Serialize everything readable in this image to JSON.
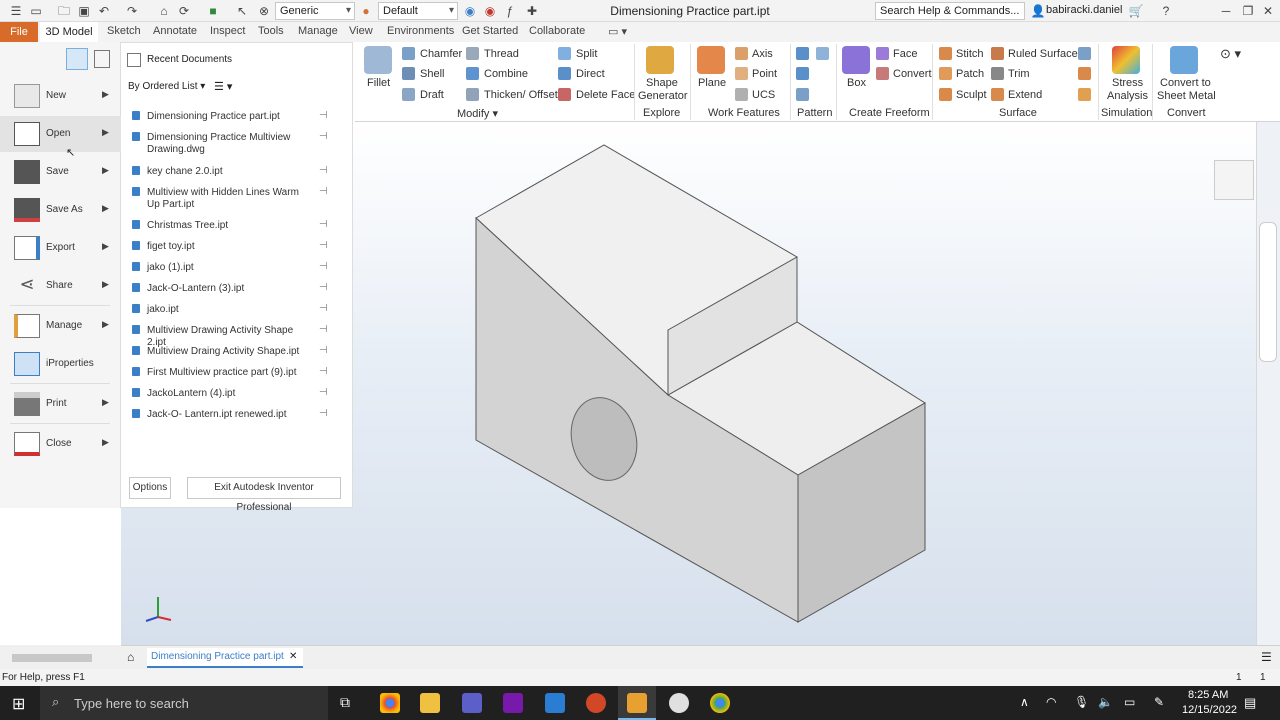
{
  "titlebar": {
    "material": "Generic",
    "appearance": "Default",
    "title": "Dimensioning Practice part.ipt",
    "search_placeholder": "Search Help & Commands...",
    "user": "babiracki.daniel"
  },
  "tabs": {
    "file": "File",
    "model": "3D Model",
    "sketch": "Sketch",
    "annotate": "Annotate",
    "inspect": "Inspect",
    "tools": "Tools",
    "manage": "Manage",
    "view": "View",
    "environments": "Environments",
    "get_started": "Get Started",
    "collaborate": "Collaborate"
  },
  "ribbon": {
    "fillet": "Fillet",
    "chamfer": "Chamfer",
    "shell": "Shell",
    "draft": "Draft",
    "thread": "Thread",
    "combine": "Combine",
    "thicken": "Thicken/ Offset",
    "split": "Split",
    "direct": "Direct",
    "delete_face": "Delete Face",
    "shape_gen_1": "Shape",
    "shape_gen_2": "Generator",
    "plane": "Plane",
    "axis": "Axis",
    "point": "Point",
    "ucs": "UCS",
    "box": "Box",
    "face": "Face",
    "convert": "Convert",
    "stitch": "Stitch",
    "patch": "Patch",
    "sculpt": "Sculpt",
    "ruled_surface": "Ruled Surface",
    "trim": "Trim",
    "extend": "Extend",
    "stress_1": "Stress",
    "stress_2": "Analysis",
    "sheet_1": "Convert to",
    "sheet_2": "Sheet Metal",
    "groups": {
      "modify": "Modify ▾",
      "explore": "Explore",
      "work_features": "Work Features",
      "pattern": "Pattern",
      "create_freeform": "Create Freeform",
      "surface": "Surface",
      "simulation": "Simulation",
      "convert": "Convert"
    }
  },
  "file_menu": {
    "items": {
      "new": "New",
      "open": "Open",
      "save": "Save",
      "save_as": "Save As",
      "export": "Export",
      "share": "Share",
      "manage": "Manage",
      "iproperties": "iProperties",
      "print": "Print",
      "close": "Close"
    },
    "recent_title": "Recent Documents",
    "sort": "By Ordered List",
    "documents": [
      "Dimensioning Practice part.ipt",
      "Dimensioning Practice Multiview Drawing.dwg",
      "key chane 2.0.ipt",
      "Multiview with Hidden Lines Warm Up Part.ipt",
      "Christmas Tree.ipt",
      "figet toy.ipt",
      "jako (1).ipt",
      "Jack-O-Lantern (3).ipt",
      "jako.ipt",
      "Multiview Drawing Activity Shape 2.ipt",
      "Multiview Draing Activity Shape.ipt",
      "First Multiview practice part (9).ipt",
      "JackoLantern (4).ipt",
      "Jack-O- Lantern.ipt renewed.ipt"
    ],
    "options": "Options",
    "exit": "Exit Autodesk Inventor Professional"
  },
  "doc_tab": "Dimensioning Practice part.ipt",
  "status": {
    "help": "For Help, press F1",
    "v1": "1",
    "v2": "1"
  },
  "taskbar": {
    "search": "Type here to search",
    "time": "8:25 AM",
    "date": "12/15/2022"
  },
  "colors": {
    "file_tab": "#d96b2a",
    "taskbar": "#202020",
    "accent": "#3b7fc7"
  }
}
